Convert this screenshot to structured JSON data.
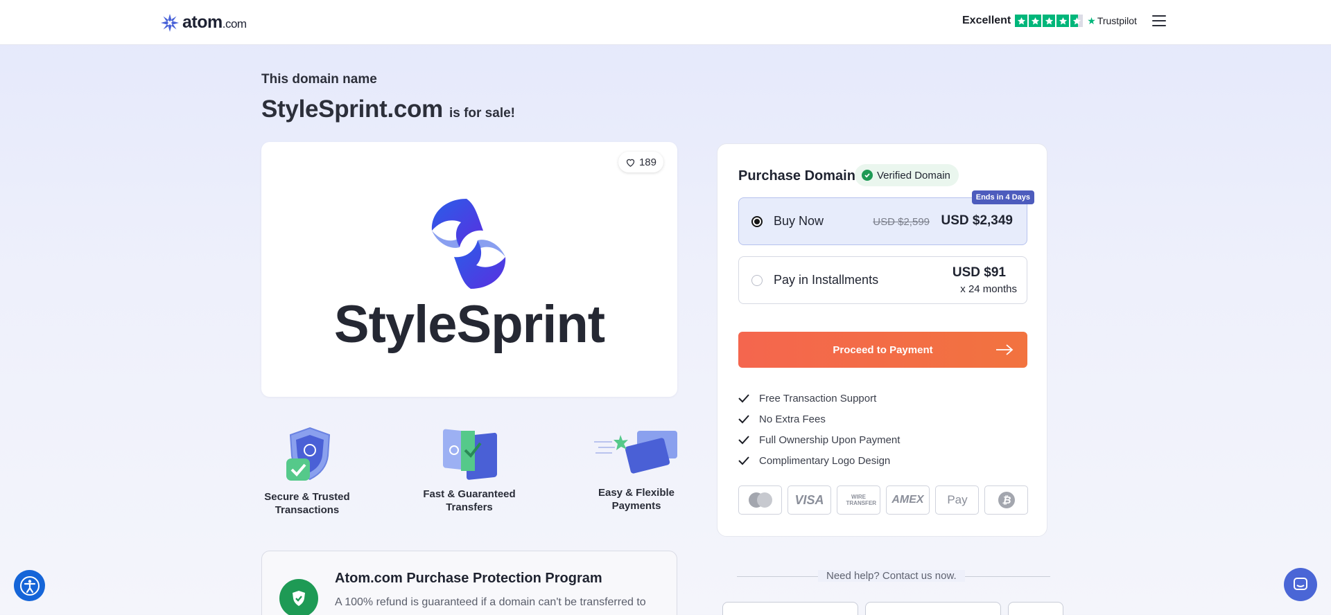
{
  "header": {
    "logo_text": "atom",
    "logo_suffix": ".com",
    "trust_label": "Excellent",
    "trust_brand": "Trustpilot",
    "rating_stars": 4.5
  },
  "intro": {
    "heading": "This domain name",
    "domain": "StyleSprint.com",
    "for_sale": "is for sale!"
  },
  "logo_card": {
    "likes": "189",
    "brand_word": "StyleSprint"
  },
  "features": [
    {
      "label_line1": "Secure & Trusted",
      "label_line2": "Transactions",
      "icon": "shield-check-icon"
    },
    {
      "label_line1": "Fast & Guaranteed",
      "label_line2": "Transfers",
      "icon": "transfer-folder-icon"
    },
    {
      "label_line1": "Easy & Flexible",
      "label_line2": "Payments",
      "icon": "card-icon"
    }
  ],
  "protection": {
    "title": "Atom.com Purchase Protection Program",
    "text": "A 100% refund is guaranteed if a domain can't be transferred to"
  },
  "purchase": {
    "title": "Purchase Domain",
    "verified": "Verified Domain",
    "buy_now": {
      "label": "Buy Now",
      "old_price": "USD $2,599",
      "price": "USD $2,349",
      "badge": "Ends in 4 Days"
    },
    "installments": {
      "label": "Pay in Installments",
      "price": "USD $91",
      "term": "x 24 months"
    },
    "proceed_label": "Proceed to Payment",
    "perks": [
      "Free Transaction Support",
      "No Extra Fees",
      "Full Ownership Upon Payment",
      "Complimentary Logo Design"
    ],
    "payment_methods": [
      "mastercard",
      "VISA",
      "WIRE TRANSFER",
      "AMEX",
      "Pay",
      "bitcoin"
    ]
  },
  "help": {
    "text": "Need help? Contact us now."
  },
  "colors": {
    "accent": "#f4664e",
    "brand_blue": "#4d5cbd",
    "verified_green": "#1e9a55",
    "trustpilot_green": "#00b67a"
  }
}
